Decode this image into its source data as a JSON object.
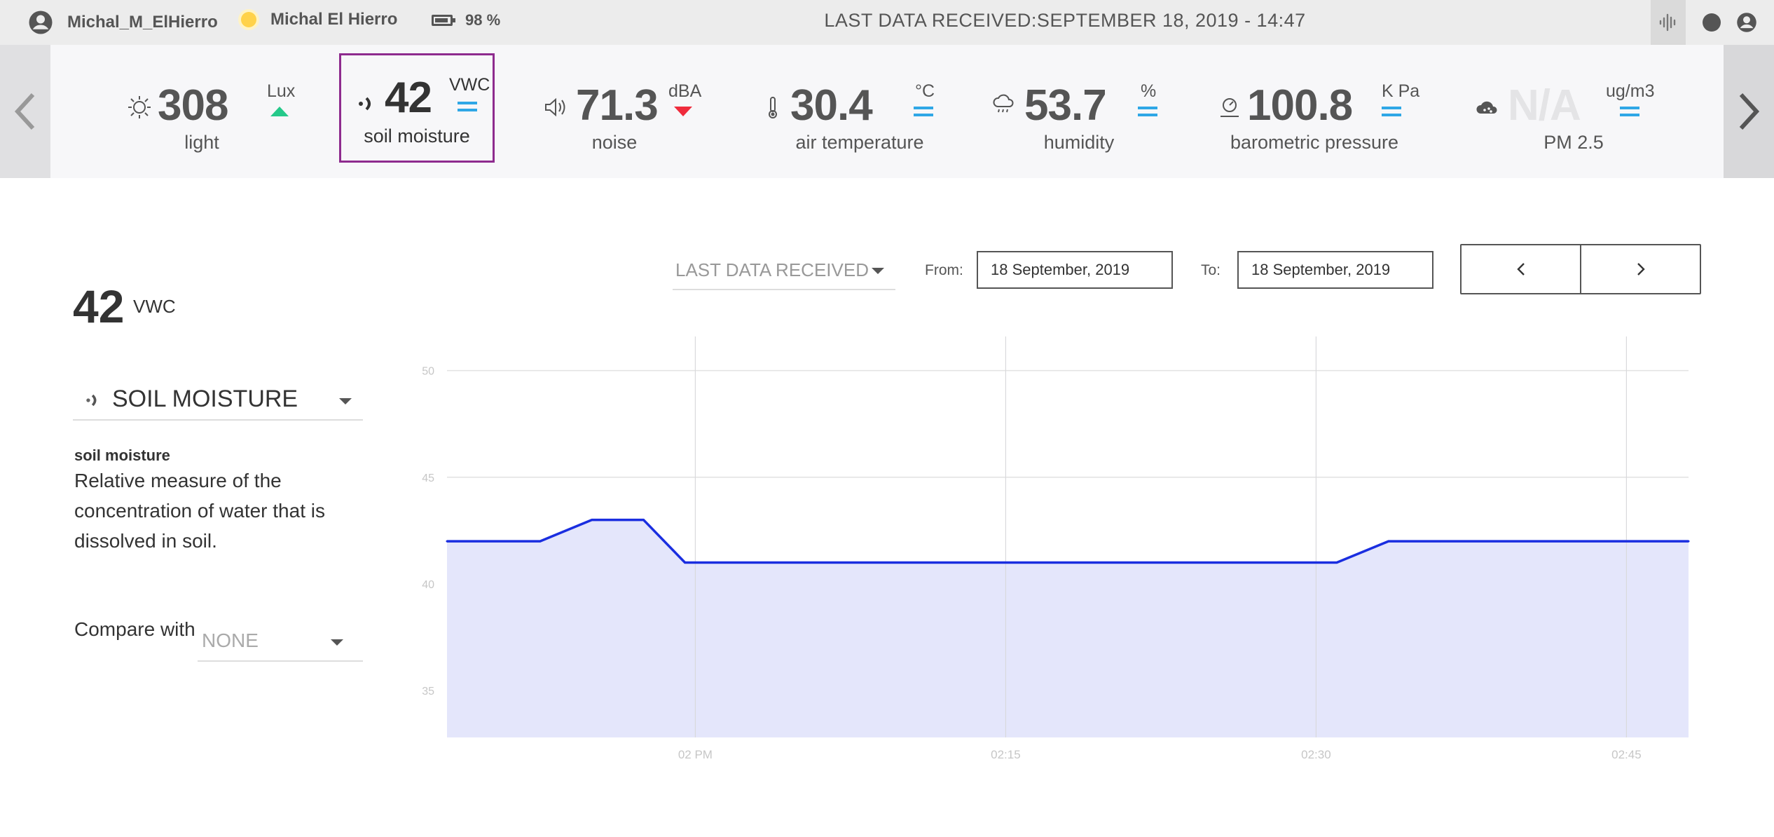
{
  "topbar": {
    "username": "Michal_M_ElHierro",
    "kit_name": "Michal El Hierro",
    "battery": "98 %",
    "last_received": "LAST DATA RECEIVED:SEPTEMBER 18, 2019 - 14:47",
    "icons": [
      "account-icon",
      "sun-status-icon",
      "battery-icon",
      "waveform-icon",
      "record-dot-icon",
      "profile-icon"
    ]
  },
  "sensors": [
    {
      "icon": "light-icon",
      "value": "308",
      "unit": "Lux",
      "name": "light",
      "trend": "up"
    },
    {
      "icon": "soil-moisture-icon",
      "value": "42",
      "unit": "VWC",
      "name": "soil moisture",
      "trend": "flat",
      "selected": true
    },
    {
      "icon": "speaker-icon",
      "value": "71.3",
      "unit": "dBA",
      "name": "noise",
      "trend": "down"
    },
    {
      "icon": "thermometer-icon",
      "value": "30.4",
      "unit": "°C",
      "name": "air temperature",
      "trend": "flat"
    },
    {
      "icon": "rain-cloud-icon",
      "value": "53.7",
      "unit": "%",
      "name": "humidity",
      "trend": "flat"
    },
    {
      "icon": "gauge-icon",
      "value": "100.8",
      "unit": "K Pa",
      "name": "barometric pressure",
      "trend": "flat"
    },
    {
      "icon": "particles-cloud-icon",
      "value": "N/A",
      "unit": "ug/m3",
      "name": "PM 2.5",
      "trend": "flat"
    }
  ],
  "detail": {
    "value": "42",
    "unit": "VWC",
    "sensor_select": "SOIL MOISTURE",
    "desc_title": "soil moisture",
    "desc_text": "Relative measure of the concentration of water that is dissolved in soil.",
    "compare_label": "Compare with",
    "compare_value": "NONE"
  },
  "controls": {
    "range": "LAST DATA RECEIVED",
    "from_label": "From:",
    "from_value": "18 September, 2019",
    "to_label": "To:",
    "to_value": "18 September, 2019",
    "prev": "‹",
    "next": "›"
  },
  "colors": {
    "line": "#1a2ee0",
    "fill": "#e4e6fb",
    "selected_border": "#8e2b8e",
    "trend_up": "#25c98a",
    "trend_down": "#ef2b3c",
    "trend_flat": "#2fa7e6"
  },
  "chart_data": {
    "type": "area",
    "x": [
      0,
      4.5,
      7,
      9.5,
      11.5,
      14,
      20,
      26,
      32,
      38,
      43,
      45.5,
      48,
      54,
      60
    ],
    "y": [
      42,
      42,
      43,
      43,
      41,
      41,
      41,
      41,
      41,
      41,
      41,
      42,
      42,
      42,
      42
    ],
    "ylim": [
      32.8,
      51.6
    ],
    "xlim": [
      0,
      60
    ],
    "yticks": [
      35,
      40,
      45,
      50
    ],
    "xticks": [
      {
        "x": 12,
        "label": "02 PM"
      },
      {
        "x": 27,
        "label": "02:15"
      },
      {
        "x": 42,
        "label": "02:30"
      },
      {
        "x": 57,
        "label": "02:45"
      }
    ],
    "grid": true
  }
}
